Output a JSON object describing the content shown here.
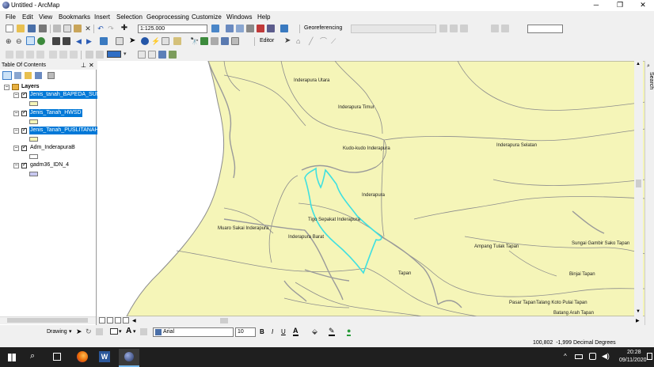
{
  "window": {
    "title": "Untitled - ArcMap"
  },
  "menu": [
    "File",
    "Edit",
    "View",
    "Bookmarks",
    "Insert",
    "Selection",
    "Geoprocessing",
    "Customize",
    "Windows",
    "Help"
  ],
  "toolbar": {
    "scale": "1:125.000",
    "georeferencing_label": "Georeferencing",
    "editor_label": "Editor"
  },
  "toc": {
    "title": "Table Of Contents",
    "group_label": "Layers",
    "layers": [
      {
        "name": "Jenis_tanah_BAPEDA_SUM",
        "selected": true,
        "swatch": "#f5f5b8"
      },
      {
        "name": "Jenis_Tanah_HWSD",
        "selected": true,
        "swatch": "#f5f5b8"
      },
      {
        "name": "Jenis_Tanah_PUSLITANAH",
        "selected": true,
        "swatch": "#f5f5b8"
      },
      {
        "name": "Adm_InderapuraB",
        "selected": false,
        "swatch": "#ffffff"
      },
      {
        "name": "gadm36_IDN_4",
        "selected": false,
        "swatch": "#c8c8f0"
      }
    ]
  },
  "map": {
    "land_color": "#f5f5b8",
    "outline_color": "#8c8c8c",
    "highlight_color": "#3fe0e0",
    "places": [
      "Inderapura Utara",
      "Inderapura Timur",
      "Kudo-kudo Inderapura",
      "Inderapura Selatan",
      "Inderapura",
      "Tigo Sepakat Inderapura",
      "Muaro Sakai Inderapura",
      "Inderapura Barat",
      "Ampang Tulak Tapan",
      "Sungai Gambir Sako Tapan",
      "Binjai Tapan",
      "Tapan",
      "Pasar Tapan",
      "Talang Koto Pulai Tapan",
      "Batang Arah Tapan"
    ]
  },
  "search_tab": {
    "label": "Search"
  },
  "drawing": {
    "drawing_label": "Drawing",
    "font": "Arial",
    "size": "10",
    "bold": "B",
    "italic": "I",
    "underline": "U",
    "text_tool": "A"
  },
  "status": {
    "coords": "100,802  -1,999 Decimal Degrees"
  },
  "taskbar": {
    "time": "20:28",
    "date": "09/11/2020"
  }
}
